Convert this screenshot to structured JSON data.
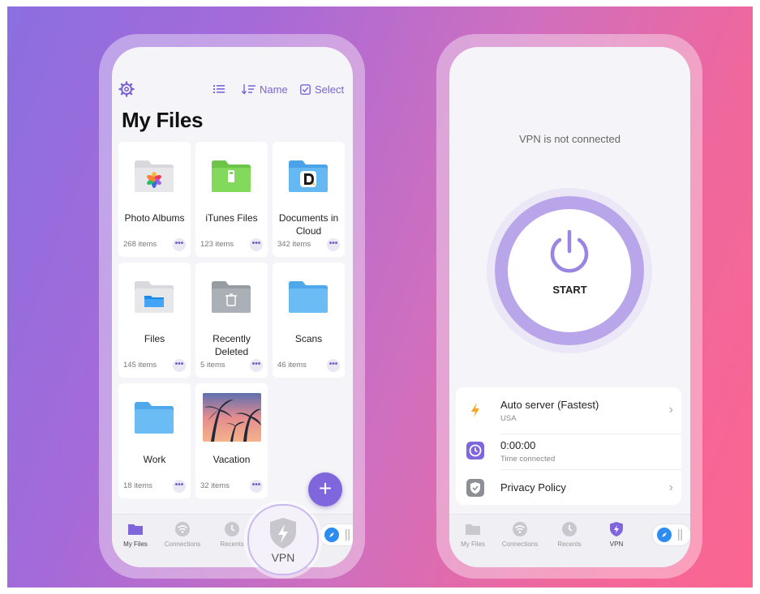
{
  "files_app": {
    "toolbar": {
      "sort_label": "Name",
      "select_label": "Select"
    },
    "title": "My Files",
    "folders": [
      {
        "name": "Photo Albums",
        "count": "268 items",
        "icon": "photos-folder-icon",
        "color": "#e3e3e6"
      },
      {
        "name": "iTunes Files",
        "count": "123 items",
        "icon": "itunes-folder-icon",
        "color": "#7ed35a"
      },
      {
        "name": "Documents in Cloud",
        "count": "342 items",
        "icon": "documents-cloud-folder-icon",
        "color": "#5fb0f0"
      },
      {
        "name": "Files",
        "count": "145 items",
        "icon": "files-folder-icon",
        "color": "#e3e3e6"
      },
      {
        "name": "Recently Deleted",
        "count": "5 items",
        "icon": "trash-folder-icon",
        "color": "#a9adb3"
      },
      {
        "name": "Scans",
        "count": "46 items",
        "icon": "folder-icon",
        "color": "#6bbcf4"
      },
      {
        "name": "Work",
        "count": "18 items",
        "icon": "folder-icon",
        "color": "#6bbcf4"
      },
      {
        "name": "Vacation",
        "count": "32 items",
        "icon": "photo-thumbnail",
        "color": "#f19a7a"
      }
    ],
    "more_glyph": "•••",
    "fab_glyph": "+",
    "tabs": [
      {
        "label": "My Files",
        "icon": "folder-icon"
      },
      {
        "label": "Connections",
        "icon": "wifi-icon"
      },
      {
        "label": "Recents",
        "icon": "clock-icon"
      }
    ],
    "vpn_bubble_label": "VPN"
  },
  "vpn_app": {
    "status": "VPN is not connected",
    "start_label": "START",
    "rows": [
      {
        "title": "Auto server (Fastest)",
        "subtitle": "USA",
        "icon": "lightning-icon",
        "chevron": "›"
      },
      {
        "title": "0:00:00",
        "subtitle": "Time connected",
        "icon": "clock-icon",
        "chevron": ""
      },
      {
        "title": "Privacy Policy",
        "subtitle": "",
        "icon": "shield-check-icon",
        "chevron": "›"
      }
    ],
    "tabs": [
      {
        "label": "My Files",
        "icon": "folder-icon"
      },
      {
        "label": "Connections",
        "icon": "wifi-icon"
      },
      {
        "label": "Recents",
        "icon": "clock-icon"
      },
      {
        "label": "VPN",
        "icon": "vpn-shield-icon"
      }
    ]
  },
  "colors": {
    "accent": "#7f66dc",
    "ring": "#b9a6ea",
    "bolt": "#f5a623"
  }
}
